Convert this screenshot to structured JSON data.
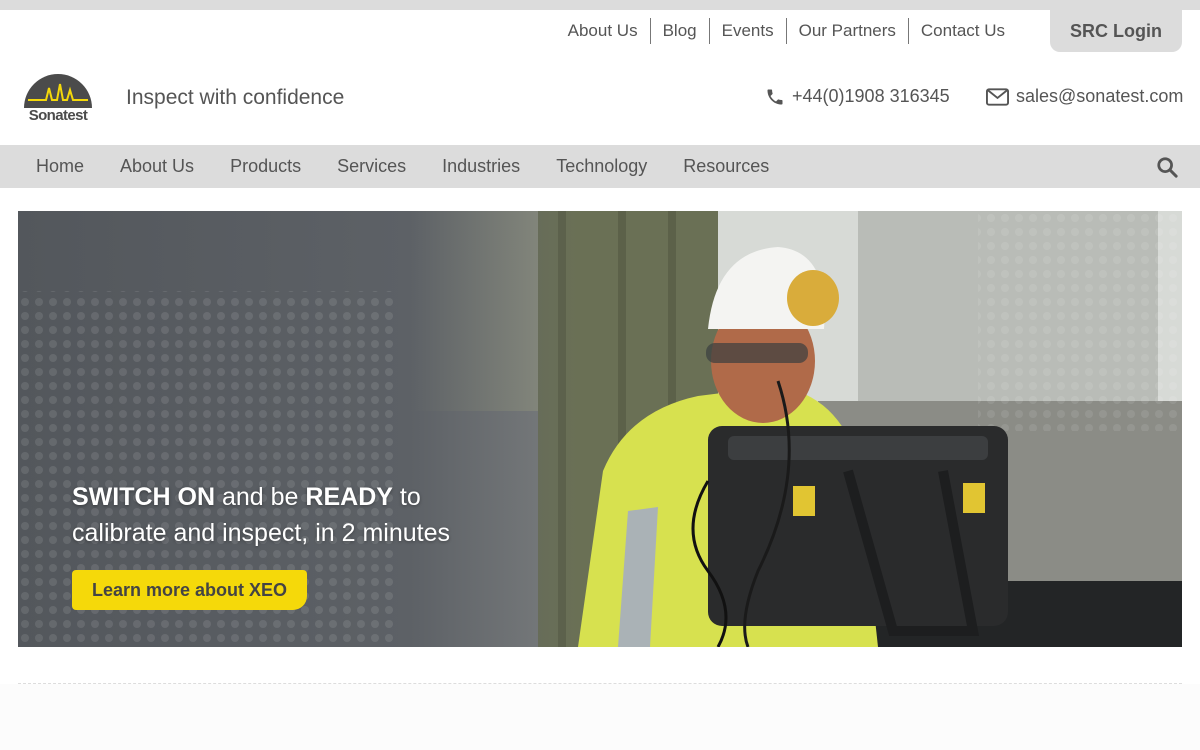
{
  "utility_nav": [
    "About Us",
    "Blog",
    "Events",
    "Our Partners",
    "Contact Us"
  ],
  "src_login": "SRC Login",
  "logo": {
    "name": "Sonatest"
  },
  "tagline": "Inspect with confidence",
  "contact": {
    "phone": "+44(0)1908 316345",
    "email": "sales@sonatest.com"
  },
  "main_nav": [
    "Home",
    "About Us",
    "Products",
    "Services",
    "Industries",
    "Technology",
    "Resources"
  ],
  "hero": {
    "switch_on": "SWITCH ON",
    "and_be": " and be ",
    "ready": "READY",
    "to": " to",
    "line2": "calibrate and inspect, in 2 minutes",
    "cta": "Learn more about XEO"
  },
  "icons": {
    "phone": "phone-icon",
    "email": "envelope-icon",
    "search": "search-icon"
  },
  "colors": {
    "accent": "#f5d90a",
    "nav_bg": "#dcdcdc",
    "text": "#555555"
  }
}
